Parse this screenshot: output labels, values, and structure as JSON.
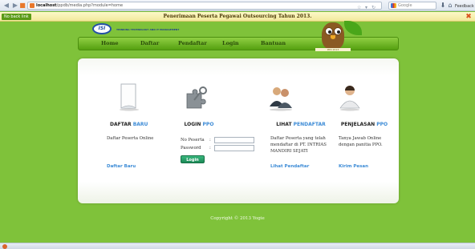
{
  "browser": {
    "url_host": "localhost",
    "url_path": "/ppdb/media.php?module=home",
    "search_placeholder": "Google",
    "feedback_label": "Feedback"
  },
  "notice": {
    "no_back_label": "No back link",
    "title": "Penerimaan Peserta Pegawai Outsourcing Tahun 2013."
  },
  "header": {
    "logo_text": "ISI",
    "org_text": "THINKING TECHNOLOGY AND IT MANAGEMENT"
  },
  "nav": {
    "items": [
      "Home",
      "Daftar",
      "Pendaftar",
      "Login",
      "Bantuan"
    ]
  },
  "owl": {
    "bar_text": "PPO  2013"
  },
  "columns": {
    "daftar": {
      "title_main": "DAFTAR",
      "title_accent": "BARU",
      "text": "Daftar Peserta Online",
      "link": "Daftar Baru"
    },
    "login": {
      "title_main": "LOGIN",
      "title_accent": "PPO",
      "fields": {
        "no_peserta_label": "No Peserta",
        "password_label": "Password"
      },
      "button": "Login"
    },
    "lihat": {
      "title_main": "LIHAT",
      "title_accent": "PENDAFTAR",
      "text": "Daftar Peserta yang telah mendaftar di PT. INTRIAS MANDIRI SEJATI",
      "link": "Lihat Pendaftar"
    },
    "penjelasan": {
      "title_main": "PENJELASAN",
      "title_accent": "PPO",
      "text": "Tanya Jawab Online dengan panitia PPO.",
      "link": "Kirim Pesan"
    }
  },
  "footer": {
    "text": "Copyright © 2013 Yogie"
  }
}
